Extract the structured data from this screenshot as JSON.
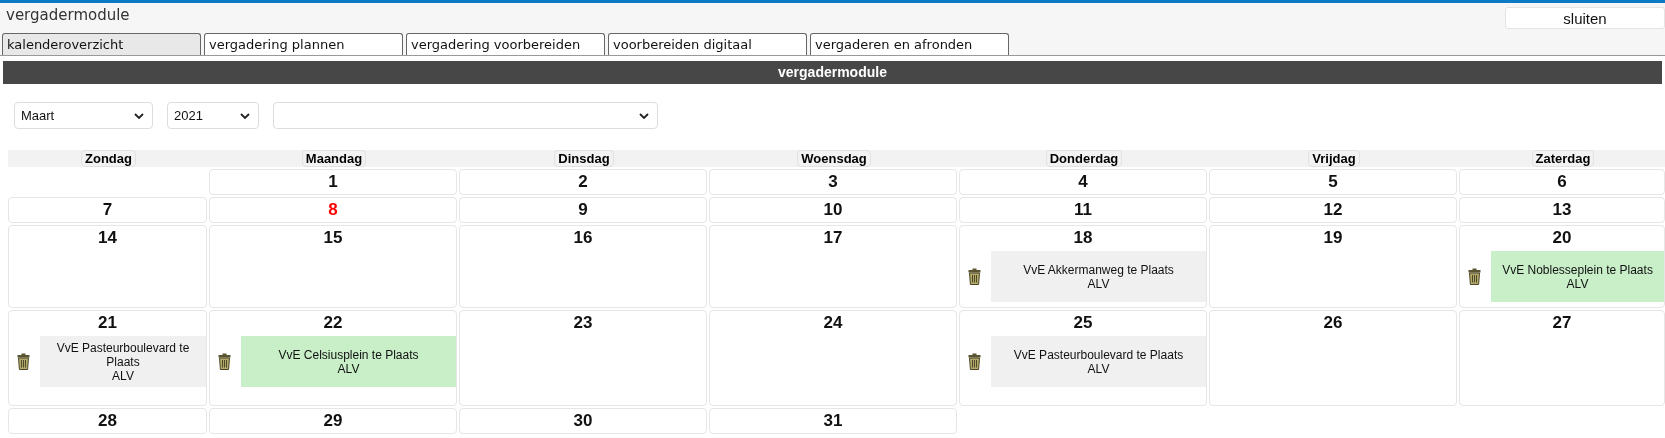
{
  "window": {
    "title": "vergadermodule"
  },
  "close_button": "sluiten",
  "tabs": [
    {
      "label": "kalenderoverzicht",
      "selected": true
    },
    {
      "label": "vergadering plannen",
      "selected": false
    },
    {
      "label": "vergadering voorbereiden",
      "selected": false
    },
    {
      "label": "voorbereiden digitaal",
      "selected": false
    },
    {
      "label": "vergaderen en afronden",
      "selected": false
    }
  ],
  "section_title": "vergadermodule",
  "filters": {
    "month": "Maart",
    "year": "2021"
  },
  "calendar": {
    "weekdays": [
      "Zondag",
      "Maandag",
      "Dinsdag",
      "Woensdag",
      "Donderdag",
      "Vrijdag",
      "Zaterdag"
    ],
    "weeks": [
      [
        {
          "kind": "blank"
        },
        {
          "day": "1",
          "today": false
        },
        {
          "day": "2",
          "today": false
        },
        {
          "day": "3",
          "today": false
        },
        {
          "day": "4",
          "today": false
        },
        {
          "day": "5",
          "today": false
        },
        {
          "day": "6",
          "today": false
        }
      ],
      [
        {
          "day": "7",
          "today": false
        },
        {
          "day": "8",
          "today": true
        },
        {
          "day": "9",
          "today": false
        },
        {
          "day": "10",
          "today": false
        },
        {
          "day": "11",
          "today": false
        },
        {
          "day": "12",
          "today": false
        },
        {
          "day": "13",
          "today": false
        }
      ],
      [
        {
          "day": "14",
          "today": false
        },
        {
          "day": "15",
          "today": false
        },
        {
          "day": "16",
          "today": false
        },
        {
          "day": "17",
          "today": false
        },
        {
          "day": "18",
          "today": false,
          "events": [
            {
              "title": "VvE Akkermanweg te Plaats",
              "type": "ALV",
              "color": "#f0f0f0"
            }
          ]
        },
        {
          "day": "19",
          "today": false
        },
        {
          "day": "20",
          "today": false,
          "events": [
            {
              "title": "VvE Noblesseplein te Plaats",
              "type": "ALV",
              "color": "#c8efc8"
            }
          ]
        }
      ],
      [
        {
          "day": "21",
          "today": false,
          "events": [
            {
              "title": "VvE Pasteurboulevard te Plaats",
              "type": "ALV",
              "color": "#f0f0f0"
            }
          ]
        },
        {
          "day": "22",
          "today": false,
          "events": [
            {
              "title": "VvE Celsiusplein te Plaats",
              "type": "ALV",
              "color": "#c8efc8"
            }
          ]
        },
        {
          "day": "23",
          "today": false
        },
        {
          "day": "24",
          "today": false
        },
        {
          "day": "25",
          "today": false,
          "events": [
            {
              "title": "VvE Pasteurboulevard te Plaats",
              "type": "ALV",
              "color": "#f0f0f0"
            }
          ]
        },
        {
          "day": "26",
          "today": false
        },
        {
          "day": "27",
          "today": false
        }
      ],
      [
        {
          "day": "28",
          "today": false
        },
        {
          "day": "29",
          "today": false
        },
        {
          "day": "30",
          "today": false
        },
        {
          "day": "31",
          "today": false
        },
        {
          "kind": "blank"
        },
        {
          "kind": "blank"
        },
        {
          "kind": "blank"
        }
      ]
    ]
  }
}
